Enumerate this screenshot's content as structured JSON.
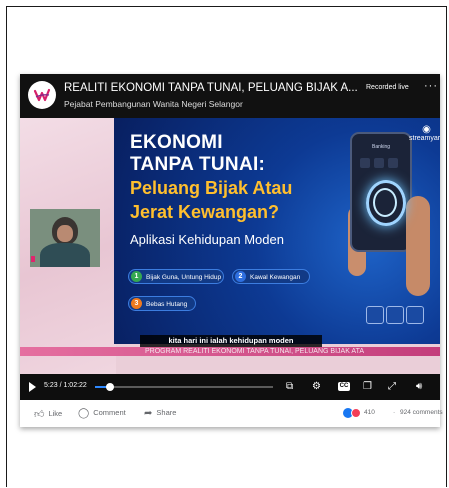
{
  "video": {
    "title": "REALITI EKONOMI TANPA TUNAI, PELUANG BIJAK A...",
    "page_name": "Pejabat Pembangunan Wanita Negeri Selangor",
    "status": "Recorded live",
    "more": "···"
  },
  "slide": {
    "line1": "EKONOMI",
    "line2": "TANPA TUNAI:",
    "line3": "Peluang Bijak Atau",
    "line4": "Jerat Kewangan?",
    "subtitle": "Aplikasi Kehidupan Moden",
    "pills": [
      {
        "num": "1",
        "label": "Bijak Guna, Untung Hidup"
      },
      {
        "num": "2",
        "label": "Kawal Kewangan"
      },
      {
        "num": "3",
        "label": "Bebas Hutang"
      }
    ],
    "phone_label": "Banking",
    "watermark": "streamyard"
  },
  "caption": "kita hari ini ialah kehidupan moden",
  "ticker": "PROGRAM REALITI EKONOMI TANPA TUNAI, PELUANG BIJAK ATA",
  "player": {
    "time": "5:23 / 1:02:22",
    "progress_fraction": 0.086
  },
  "footer": {
    "like": "Like",
    "comment": "Comment",
    "share": "Share",
    "reactions": "410",
    "separator": "·",
    "comments": "924 comments"
  },
  "colors": {
    "accent": "#2d88ff",
    "slide_highlight": "#ffbf2e",
    "ticker": "#d24b8a"
  }
}
